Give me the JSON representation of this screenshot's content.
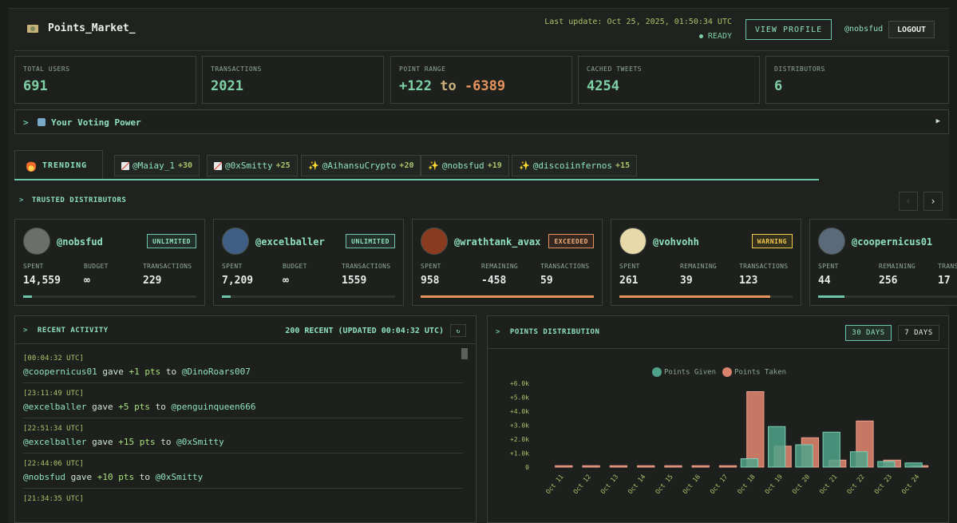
{
  "header": {
    "title": "Points_Market_",
    "last_update": "Last update: Oct 25, 2025, 01:50:34 UTC",
    "status": "READY",
    "view_profile": "VIEW PROFILE",
    "username": "@nobsfud",
    "logout": "LOGOUT"
  },
  "stats": {
    "total_users": {
      "label": "TOTAL USERS",
      "value": "691"
    },
    "transactions": {
      "label": "TRANSACTIONS",
      "value": "2021"
    },
    "point_range": {
      "label": "POINT RANGE",
      "max": "+122",
      "to": "to",
      "min": "-6389"
    },
    "cached_tweets": {
      "label": "CACHED TWEETS",
      "value": "4254"
    },
    "distributors": {
      "label": "DISTRIBUTORS",
      "value": "6"
    }
  },
  "voting": {
    "label": "Your Voting Power"
  },
  "trending": {
    "title": "TRENDING",
    "items": [
      {
        "icon": "chart",
        "name": "@Maiay_1",
        "delta": "+30"
      },
      {
        "icon": "chart",
        "name": "@0xSmitty",
        "delta": "+25"
      },
      {
        "icon": "sparkle",
        "name": "@AihansuCrypto",
        "delta": "+20"
      },
      {
        "icon": "sparkle",
        "name": "@nobsfud",
        "delta": "+19"
      },
      {
        "icon": "sparkle",
        "name": "@discoiinfernos",
        "delta": "+15"
      }
    ]
  },
  "distributors": {
    "title": "TRUSTED DISTRIBUTORS",
    "prev": "‹",
    "next": "›",
    "cards": [
      {
        "name": "@nobsfud",
        "badge": "UNLIMITED",
        "badge_type": "unlimited",
        "l1": "SPENT",
        "v1": "14,559",
        "l2": "BUDGET",
        "v2": "∞",
        "l3": "TRANSACTIONS",
        "v3": "229",
        "progress": 0.05,
        "over": false,
        "avatar_color": "#6b6f6b"
      },
      {
        "name": "@excelballer",
        "badge": "UNLIMITED",
        "badge_type": "unlimited",
        "l1": "SPENT",
        "v1": "7,209",
        "l2": "BUDGET",
        "v2": "∞",
        "l3": "TRANSACTIONS",
        "v3": "1559",
        "progress": 0.05,
        "over": false,
        "avatar_color": "#3f5e86"
      },
      {
        "name": "@wrathtank_avax",
        "badge": "EXCEEDED",
        "badge_type": "exceeded",
        "l1": "SPENT",
        "v1": "958",
        "l2": "REMAINING",
        "v2": "-458",
        "l3": "TRANSACTIONS",
        "v3": "59",
        "progress": 1.0,
        "over": true,
        "avatar_color": "#8a3a1e"
      },
      {
        "name": "@vohvohh",
        "badge": "WARNING",
        "badge_type": "warning",
        "l1": "SPENT",
        "v1": "261",
        "l2": "REMAINING",
        "v2": "39",
        "l3": "TRANSACTIONS",
        "v3": "123",
        "progress": 0.87,
        "over": true,
        "avatar_color": "#e8d9a8"
      },
      {
        "name": "@coopernicus01",
        "badge": "",
        "badge_type": "",
        "l1": "SPENT",
        "v1": "44",
        "l2": "REMAINING",
        "v2": "256",
        "l3": "TRANSACTIONS",
        "v3": "17",
        "progress": 0.15,
        "over": false,
        "avatar_color": "#5a6a7a"
      }
    ]
  },
  "activity": {
    "title": "RECENT ACTIVITY",
    "status": "200 RECENT (UPDATED 00:04:32 UTC)",
    "refresh": "↻",
    "items": [
      {
        "time": "[00:04:32 UTC]",
        "from": "@coopernicus01",
        "verb": "gave",
        "pts": "+1 pts",
        "to": "to",
        "target": "@DinoRoars007"
      },
      {
        "time": "[23:11:49 UTC]",
        "from": "@excelballer",
        "verb": "gave",
        "pts": "+5 pts",
        "to": "to",
        "target": "@penguinqueen666"
      },
      {
        "time": "[22:51:34 UTC]",
        "from": "@excelballer",
        "verb": "gave",
        "pts": "+15 pts",
        "to": "to",
        "target": "@0xSmitty"
      },
      {
        "time": "[22:44:06 UTC]",
        "from": "@nobsfud",
        "verb": "gave",
        "pts": "+10 pts",
        "to": "to",
        "target": "@0xSmitty"
      },
      {
        "time": "[21:34:35 UTC]",
        "from": "",
        "verb": "",
        "pts": "",
        "to": "",
        "target": ""
      }
    ]
  },
  "points_distribution": {
    "title": "POINTS DISTRIBUTION",
    "range_30": "30 DAYS",
    "range_7": "7 DAYS",
    "selected_range": "30 DAYS"
  },
  "chart_data": {
    "type": "bar",
    "title": "",
    "xlabel": "",
    "ylabel": "",
    "categories": [
      "Oct 11",
      "Oct 12",
      "Oct 13",
      "Oct 14",
      "Oct 15",
      "Oct 16",
      "Oct 17",
      "Oct 18",
      "Oct 19",
      "Oct 20",
      "Oct 21",
      "Oct 22",
      "Oct 23",
      "Oct 24"
    ],
    "series": [
      {
        "name": "Points Given",
        "color": "#4fa38a",
        "values": [
          0,
          0,
          0,
          0,
          0,
          0,
          0,
          600,
          2900,
          1600,
          2500,
          1100,
          400,
          300
        ]
      },
      {
        "name": "Points Taken",
        "color": "#d9826e",
        "values": [
          100,
          100,
          100,
          100,
          100,
          100,
          100,
          5400,
          1500,
          2100,
          500,
          3300,
          500,
          100
        ]
      }
    ],
    "yticks": [
      "0",
      "+1.0k",
      "+2.0k",
      "+3.0k",
      "+4.0k",
      "+5.0k",
      "+6.0k"
    ],
    "ylim": [
      0,
      6000
    ],
    "legend": "top-center"
  }
}
